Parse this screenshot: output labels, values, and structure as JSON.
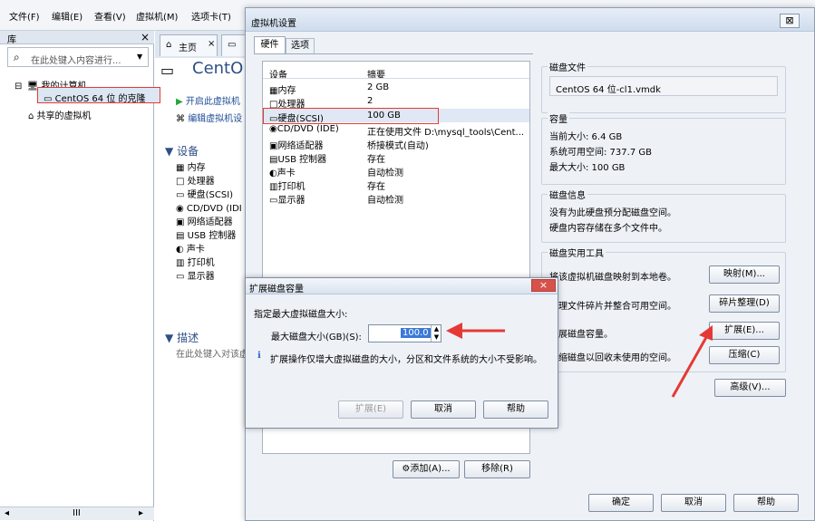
{
  "menu": [
    "文件(F)",
    "编辑(E)",
    "查看(V)",
    "虚拟机(M)",
    "选项卡(T)"
  ],
  "library": {
    "title": "库",
    "close": "×",
    "search_placeholder": "在此处键入内容进行...",
    "tree": {
      "my_computer": "我的计算机",
      "vm_clone": "CentOS 64 位 的克隆",
      "shared": "共享的虚拟机"
    },
    "scroll_text": "III"
  },
  "tabs": {
    "home": "主页",
    "home_close": "×"
  },
  "page": {
    "vm_title": "CentO",
    "actions": [
      "开启此虚拟机",
      "编辑虚拟机设"
    ],
    "devices_title": "设备",
    "devices": [
      "内存",
      "处理器",
      "硬盘(SCSI)",
      "CD/DVD (IDI",
      "网络适配器",
      "USB 控制器",
      "声卡",
      "打印机",
      "显示器"
    ],
    "desc_title": "描述",
    "desc_text": "在此处键入对该虚"
  },
  "settings": {
    "title": "虚拟机设置",
    "close": "⊠",
    "tabs": [
      "硬件",
      "选项"
    ],
    "headers": [
      "设备",
      "摘要"
    ],
    "rows": [
      [
        "内存",
        "2 GB"
      ],
      [
        "处理器",
        "2"
      ],
      [
        "硬盘(SCSI)",
        "100 GB"
      ],
      [
        "CD/DVD (IDE)",
        "正在使用文件 D:\\mysql_tools\\Cent..."
      ],
      [
        "网络适配器",
        "桥接模式(自动)"
      ],
      [
        "USB 控制器",
        "存在"
      ],
      [
        "声卡",
        "自动检测"
      ],
      [
        "打印机",
        "存在"
      ],
      [
        "显示器",
        "自动检测"
      ]
    ],
    "add": "添加(A)...",
    "remove": "移除(R)",
    "disk_file_title": "磁盘文件",
    "disk_file": "CentOS 64 位-cl1.vmdk",
    "capacity_title": "容量",
    "current_size": "当前大小: 6.4 GB",
    "free_space": "系统可用空间: 737.7 GB",
    "max_size": "最大大小: 100 GB",
    "disk_info_title": "磁盘信息",
    "disk_info_1": "没有为此硬盘预分配磁盘空间。",
    "disk_info_2": "硬盘内容存储在多个文件中。",
    "utility_title": "磁盘实用工具",
    "utility": [
      [
        "将该虚拟机磁盘映射到本地卷。",
        "映射(M)..."
      ],
      [
        "整理文件碎片并整合可用空间。",
        "碎片整理(D)"
      ],
      [
        "扩展磁盘容量。",
        "扩展(E)..."
      ],
      [
        "压缩磁盘以回收未使用的空间。",
        "压缩(C)"
      ]
    ],
    "advanced": "高级(V)...",
    "ok": "确定",
    "cancel": "取消",
    "help": "帮助"
  },
  "expand": {
    "title": "扩展磁盘容量",
    "close": "×",
    "label": "指定最大虚拟磁盘大小:",
    "max_label": "最大磁盘大小(GB)(S):",
    "value": "100.0",
    "info": "扩展操作仅增大虚拟磁盘的大小，分区和文件系统的大小不受影响。",
    "expand_btn": "扩展(E)",
    "cancel": "取消",
    "help": "帮助"
  },
  "colors": {
    "annotation": "#e53935",
    "accent": "#2f4f86",
    "selected": "#dfe8f4"
  }
}
